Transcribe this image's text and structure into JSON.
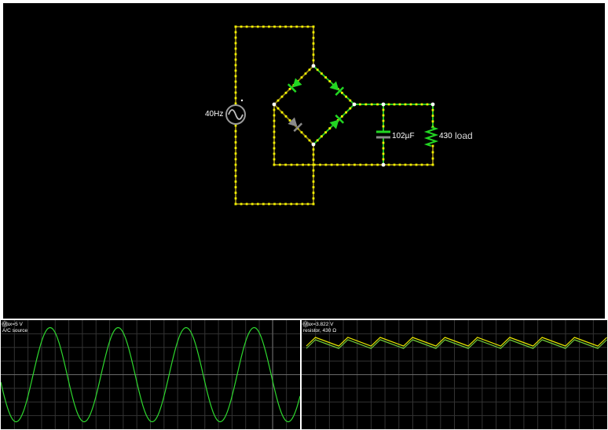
{
  "circuit": {
    "source_label": "40Hz",
    "capacitor_label": "102µF",
    "resistor_value_label": "430",
    "resistor_name_label": "load"
  },
  "scopes": [
    {
      "max_label": "Max=5 V",
      "name_label": "A/C source",
      "trace_color": "#2ed82e",
      "waveform": "sine",
      "cycles_shown": 4.4
    },
    {
      "max_label": "Max=3.822 V",
      "name_label": "resistor, 430 Ω",
      "trace_color": "#e6e600",
      "waveform": "rectified ripple",
      "ripple_peaks_shown": 9
    }
  ],
  "colors": {
    "background": "#000000",
    "wire_active": "#e6e600",
    "wire_inactive": "#808080",
    "current_dots": "#f2f200",
    "diode_conducting": "#22d622",
    "diode_off": "#8a8a8a",
    "scope_grid": "#333333"
  },
  "icons": {
    "source": "ac-source-icon",
    "scope_settings": "gear-icon"
  }
}
